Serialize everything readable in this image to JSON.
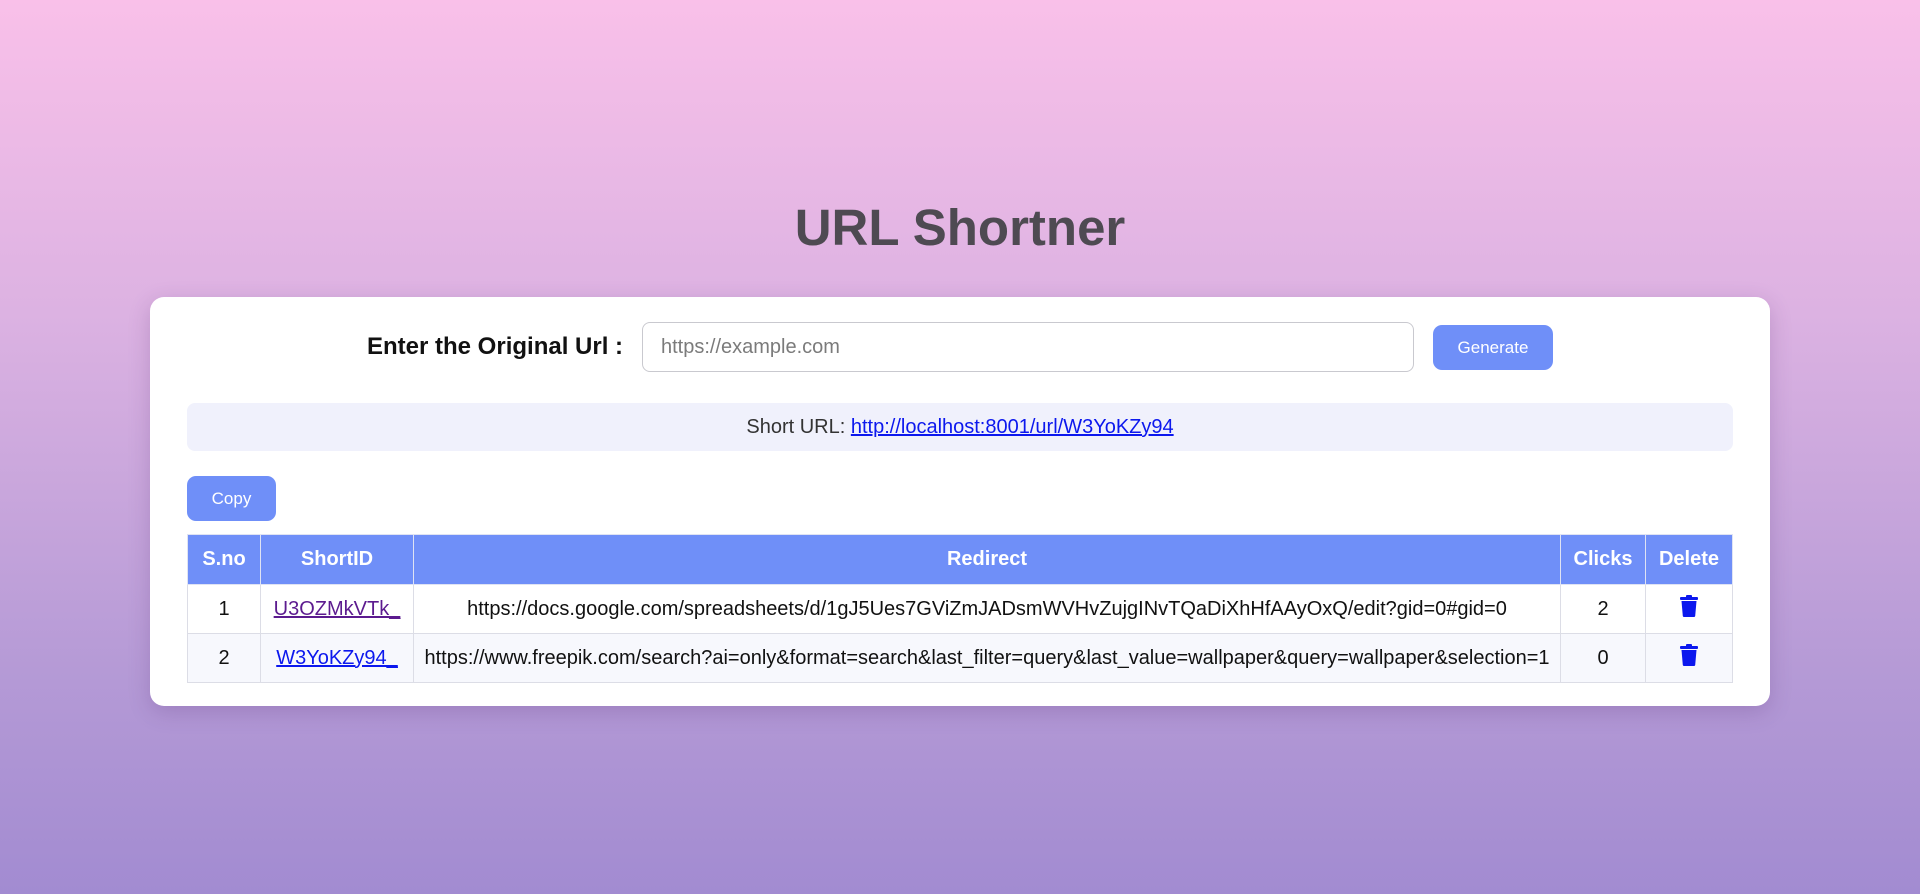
{
  "page": {
    "title": "URL Shortner"
  },
  "form": {
    "label": "Enter the Original Url :",
    "input_value": "",
    "input_placeholder": "https://example.com",
    "generate_label": "Generate"
  },
  "short_url": {
    "prefix": "Short URL: ",
    "link": "http://localhost:8001/url/W3YoKZy94"
  },
  "copy_label": "Copy",
  "table": {
    "headers": [
      "S.no",
      "ShortID",
      "Redirect",
      "Clicks",
      "Delete"
    ],
    "rows": [
      {
        "sno": "1",
        "short_id": "U3OZMkVTk_",
        "redirect": "https://docs.google.com/spreadsheets/d/1gJ5Ues7GViZmJADsmWVHvZujgINvTQaDiXhHfAAyOxQ/edit?gid=0#gid=0",
        "clicks": "2",
        "delete_icon": "trash-icon"
      },
      {
        "sno": "2",
        "short_id": "W3YoKZy94_",
        "redirect": "https://www.freepik.com/search?ai=only&format=search&last_filter=query&last_value=wallpaper&query=wallpaper&selection=1",
        "clicks": "0",
        "delete_icon": "trash-icon"
      }
    ]
  },
  "colors": {
    "accent": "#6f8ff8",
    "link": "#0c18ee",
    "visited_link": "#5c1b8f",
    "title": "#4e4a52",
    "background_top": "#f9c0e9",
    "background_bottom": "#a28bd1"
  }
}
